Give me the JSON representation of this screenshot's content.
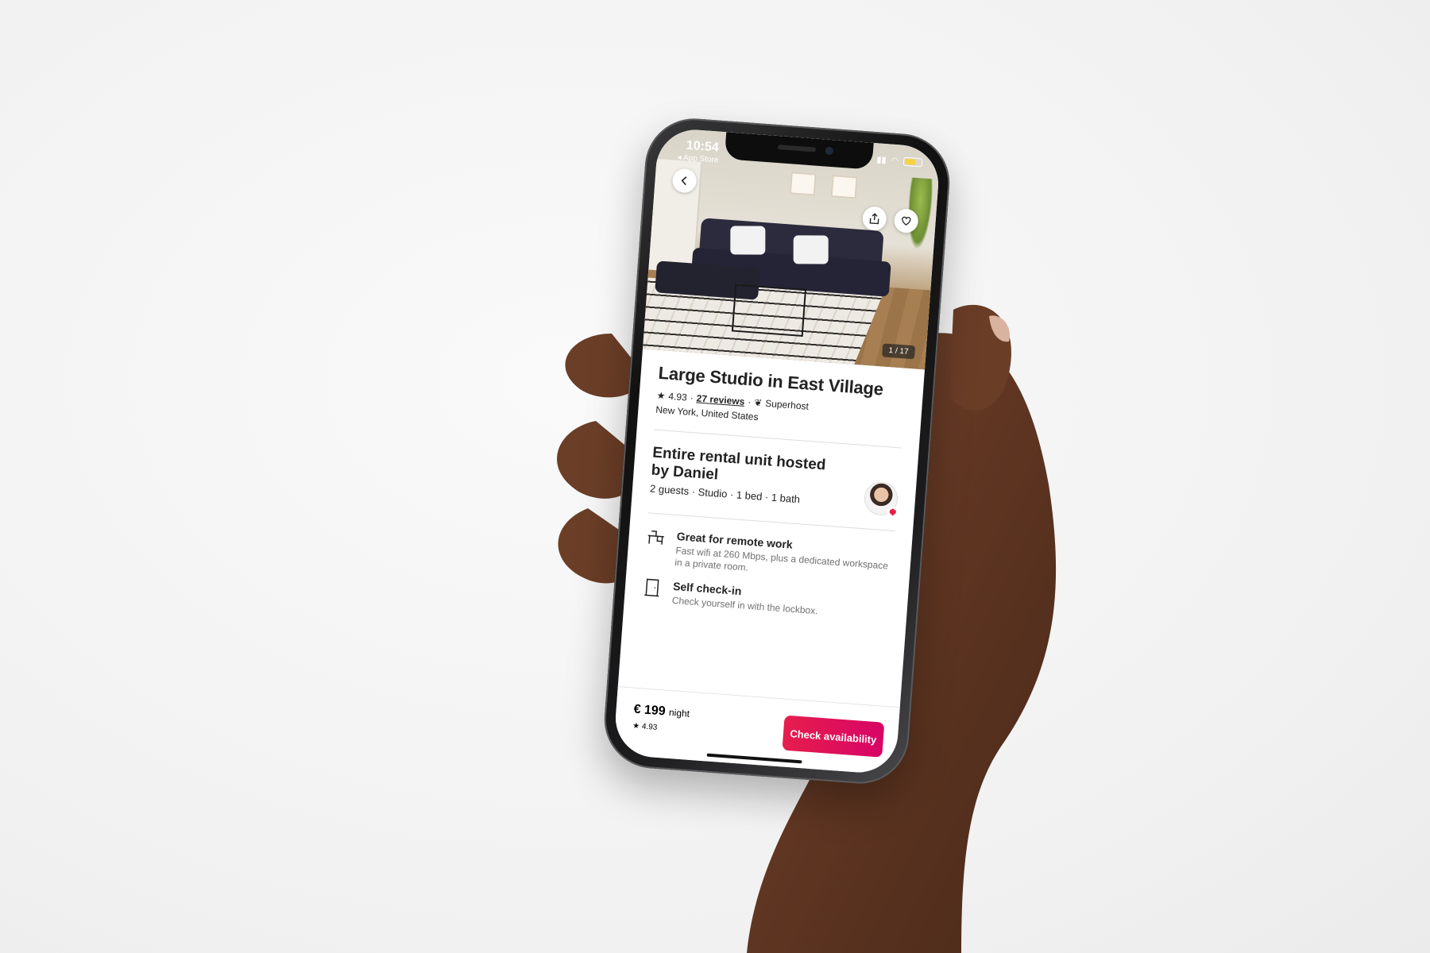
{
  "status_bar": {
    "time": "10:54",
    "back_app": "◂ App Store"
  },
  "hero": {
    "photo_counter": "1 / 17"
  },
  "listing": {
    "title": "Large Studio in East Village",
    "rating": "4.93",
    "reviews": "27 reviews",
    "host_badge": "Superhost",
    "location": "New York, United States"
  },
  "host": {
    "title": "Entire rental unit hosted by Daniel",
    "details": "2 guests · Studio · 1 bed · 1 bath"
  },
  "features": [
    {
      "icon": "desk-icon",
      "title": "Great for remote work",
      "description": "Fast wifi at 260 Mbps, plus a dedicated workspace in a private room."
    },
    {
      "icon": "door-icon",
      "title": "Self check-in",
      "description": "Check yourself in with the lockbox."
    }
  ],
  "footer": {
    "price": "€ 199",
    "price_unit": "night",
    "rating": "4.93",
    "cta_label": "Check availability"
  },
  "colors": {
    "brand": "#e61e4d",
    "text": "#222222",
    "muted": "#717171"
  }
}
